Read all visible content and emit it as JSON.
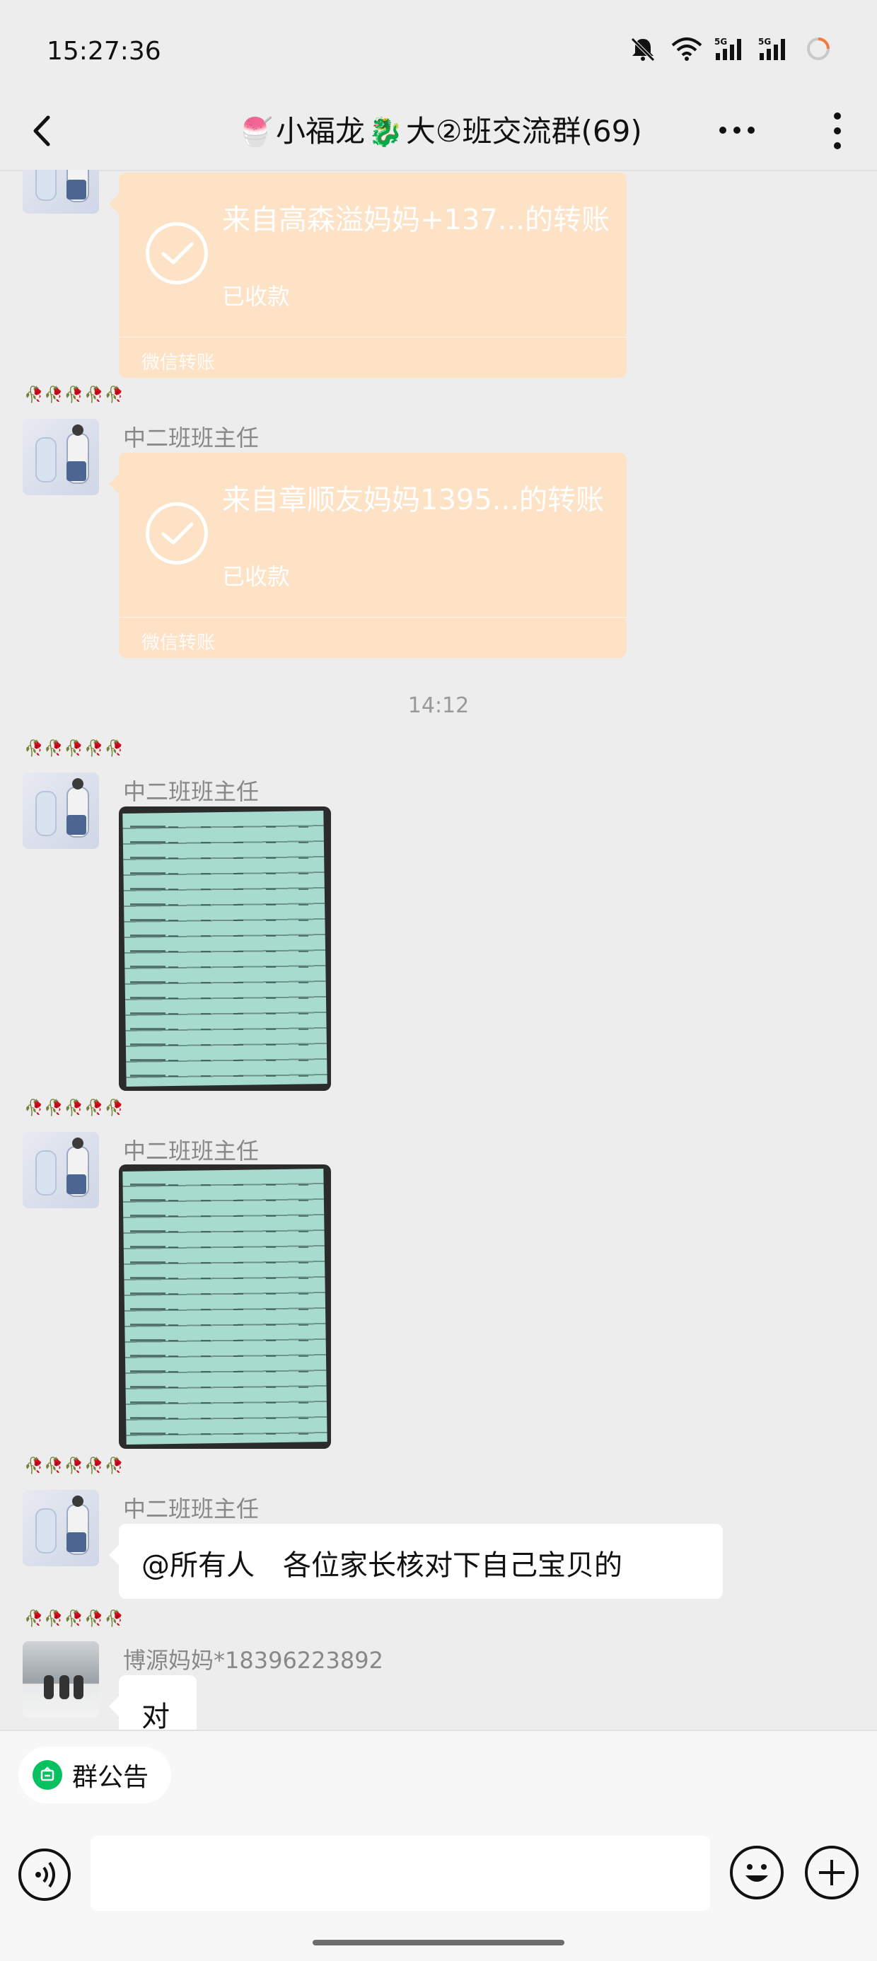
{
  "status": {
    "time": "15:27:36",
    "icons": [
      "mute-bell-icon",
      "wifi-icon",
      "signal-5g-icon",
      "signal-5g-icon",
      "battery-ring-icon"
    ]
  },
  "header": {
    "title_prefix_emoji": "🍧",
    "title_a": "小福龙",
    "title_emoji2": "🐉",
    "title_b": "大②班交流群(69)",
    "back_icon": "chevron-left-icon",
    "more_icon": "more-horizontal-icon",
    "kebab_icon": "more-vertical-icon"
  },
  "messages": [
    {
      "type": "transfer",
      "line1": "来自高森溢妈妈+137...的转账",
      "status": "已收款",
      "footer": "微信转账"
    },
    {
      "type": "transfer",
      "flowers": "🥀🥀🥀🥀🥀",
      "sender": "中二班班主任",
      "line1": "来自章顺友妈妈1395...的转账",
      "status": "已收款",
      "footer": "微信转账"
    },
    {
      "type": "time",
      "text": "14:12"
    },
    {
      "type": "image",
      "flowers": "🥀🥀🥀🥀🥀",
      "sender": "中二班班主任"
    },
    {
      "type": "image",
      "flowers": "🥀🥀🥀🥀🥀",
      "sender": "中二班班主任"
    },
    {
      "type": "text",
      "flowers": "🥀🥀🥀🥀🥀",
      "sender": "中二班班主任",
      "text": "@所有人　各位家长核对下自己宝贝的"
    },
    {
      "type": "text",
      "flowers": "🥀🥀🥀🥀🥀",
      "sender": "博源妈妈*18396223892",
      "text": "对"
    }
  ],
  "notice": {
    "label": "群公告"
  },
  "input": {
    "placeholder": ""
  },
  "colors": {
    "transfer": "#fde2c6",
    "background": "#ededed",
    "accent": "#07c160"
  }
}
